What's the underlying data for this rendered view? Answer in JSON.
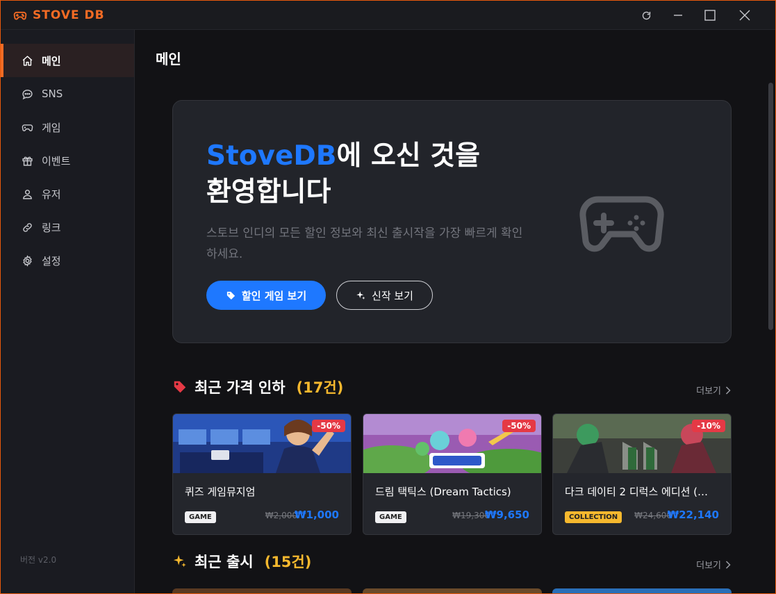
{
  "app": {
    "title": "STOVE DB",
    "version": "버전 v2.0"
  },
  "window_controls": [
    "refresh-icon",
    "minimize-icon",
    "maximize-icon",
    "close-icon"
  ],
  "colors": {
    "brand": "#f36b24",
    "accent": "#1e78ff",
    "discount": "#e53945",
    "count": "#f5b82e"
  },
  "sidebar": {
    "items": [
      {
        "label": "메인",
        "icon": "home-icon",
        "active": true
      },
      {
        "label": "SNS",
        "icon": "chat-icon",
        "active": false
      },
      {
        "label": "게임",
        "icon": "gamepad-icon",
        "active": false
      },
      {
        "label": "이벤트",
        "icon": "gift-icon",
        "active": false
      },
      {
        "label": "유저",
        "icon": "user-icon",
        "active": false
      },
      {
        "label": "링크",
        "icon": "link-icon",
        "active": false
      },
      {
        "label": "설정",
        "icon": "gear-icon",
        "active": false
      }
    ]
  },
  "main": {
    "title": "메인",
    "hero": {
      "title_accent": "StoveDB",
      "title_rest": "에 오신 것을",
      "title_line2": "환영합니다",
      "description": "스토브 인디의 모든 할인 정보와 최신 출시작을 가장 빠르게 확인하세요.",
      "primary_button": "할인 게임 보기",
      "secondary_button": "신작 보기"
    },
    "sections": [
      {
        "title": "최근 가격 인하",
        "count": "(17건)",
        "more": "더보기",
        "icon": "tag-icon"
      },
      {
        "title": "최근 출시",
        "count": "(15건)",
        "more": "더보기",
        "icon": "sparkle-icon"
      }
    ],
    "price_drops": [
      {
        "title": "퀴즈 게임뮤지엄",
        "discount": "-50%",
        "type": "GAME",
        "original_price": "₩2,000",
        "price": "₩1,000"
      },
      {
        "title": "드림 택틱스 (Dream Tactics)",
        "discount": "-50%",
        "type": "GAME",
        "original_price": "₩19,300",
        "price": "₩9,650"
      },
      {
        "title": "다크 데이티 2 디럭스 에디션 (…",
        "discount": "-10%",
        "type": "COLLECTION",
        "original_price": "₩24,600",
        "price": "₩22,140"
      }
    ]
  }
}
